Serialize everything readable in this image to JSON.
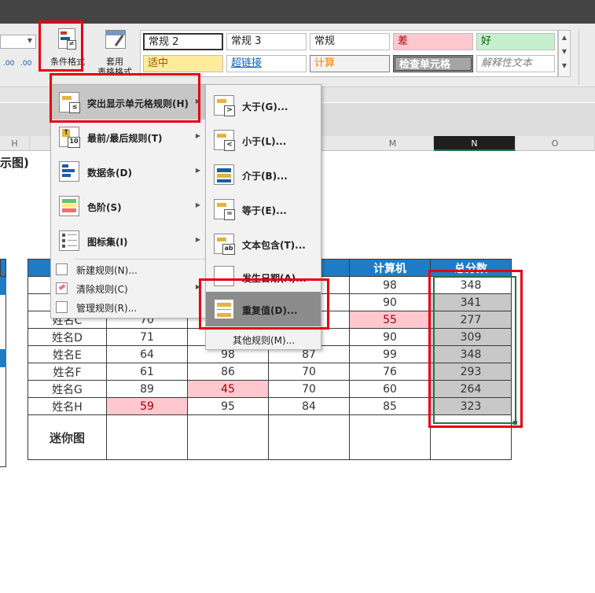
{
  "ribbon": {
    "cond_format_label": "条件格式",
    "table_format_label": "套用\n表格格式",
    "number_buttons": [
      ".00",
      ".00"
    ],
    "styles_row1": [
      {
        "label": "常规 2",
        "bg": "#ffffff"
      },
      {
        "label": "常规 3",
        "bg": "#ffffff"
      },
      {
        "label": "常规",
        "bg": "#ffffff"
      },
      {
        "label": "差",
        "bg": "#ffc7ce",
        "color": "#9c0006"
      },
      {
        "label": "好",
        "bg": "#c6efce",
        "color": "#006100"
      }
    ],
    "styles_row2": [
      {
        "label": "适中",
        "bg": "#ffeb9c",
        "color": "#9c5700"
      },
      {
        "label": "超链接",
        "bg": "#ffffff",
        "color": "#0563c1"
      },
      {
        "label": "计算",
        "bg": "#f2f2f2",
        "color": "#fa7d00"
      },
      {
        "label": "检查单元格",
        "bg": "#a5a5a5",
        "color": "#ffffff"
      },
      {
        "label": "解释性文本",
        "bg": "#ffffff",
        "color": "#7f7f7f"
      }
    ]
  },
  "columns": {
    "h": "H",
    "m": "M",
    "n": "N",
    "o": "O"
  },
  "sheet_title_fragment": "示图)",
  "table": {
    "header": [
      "",
      "",
      "",
      "",
      "计算机",
      "总分数"
    ],
    "rows": [
      {
        "name": "",
        "c1": "",
        "c2": "",
        "c3": "",
        "pc": "98",
        "total": "348"
      },
      {
        "name": "",
        "c1": "",
        "c2": "",
        "c3": "",
        "pc": "90",
        "total": "341"
      },
      {
        "name": "姓名C",
        "c1": "70",
        "c2": "",
        "c3": "",
        "pc": "55",
        "total": "277"
      },
      {
        "name": "姓名D",
        "c1": "71",
        "c2": "",
        "c3": "",
        "pc": "90",
        "total": "309"
      },
      {
        "name": "姓名E",
        "c1": "64",
        "c2": "98",
        "c3": "87",
        "pc": "99",
        "total": "348"
      },
      {
        "name": "姓名F",
        "c1": "61",
        "c2": "86",
        "c3": "70",
        "pc": "76",
        "total": "293"
      },
      {
        "name": "姓名G",
        "c1": "89",
        "c2": "45",
        "c3": "70",
        "pc": "60",
        "total": "264"
      },
      {
        "name": "姓名H",
        "c1": "59",
        "c2": "95",
        "c3": "84",
        "pc": "85",
        "total": "323"
      }
    ],
    "sparkline_label": "迷你图"
  },
  "menu": {
    "items": [
      {
        "label": "突出显示单元格规则(H)"
      },
      {
        "label": "最前/最后规则(T)"
      },
      {
        "label": "数据条(D)"
      },
      {
        "label": "色阶(S)"
      },
      {
        "label": "图标集(I)"
      }
    ],
    "plain_items": [
      {
        "label": "新建规则(N)..."
      },
      {
        "label": "清除规则(C)"
      },
      {
        "label": "管理规则(R)..."
      }
    ]
  },
  "submenu": {
    "items": [
      {
        "label": "大于(G)...",
        "icon": ">"
      },
      {
        "label": "小于(L)...",
        "icon": "<"
      },
      {
        "label": "介于(B)...",
        "icon": ""
      },
      {
        "label": "等于(E)...",
        "icon": "="
      },
      {
        "label": "文本包含(T)...",
        "icon": "ab"
      },
      {
        "label": "发生日期(A)...",
        "icon": ""
      },
      {
        "label": "重复值(D)...",
        "icon": ""
      }
    ],
    "more": "其他规则(M)..."
  }
}
